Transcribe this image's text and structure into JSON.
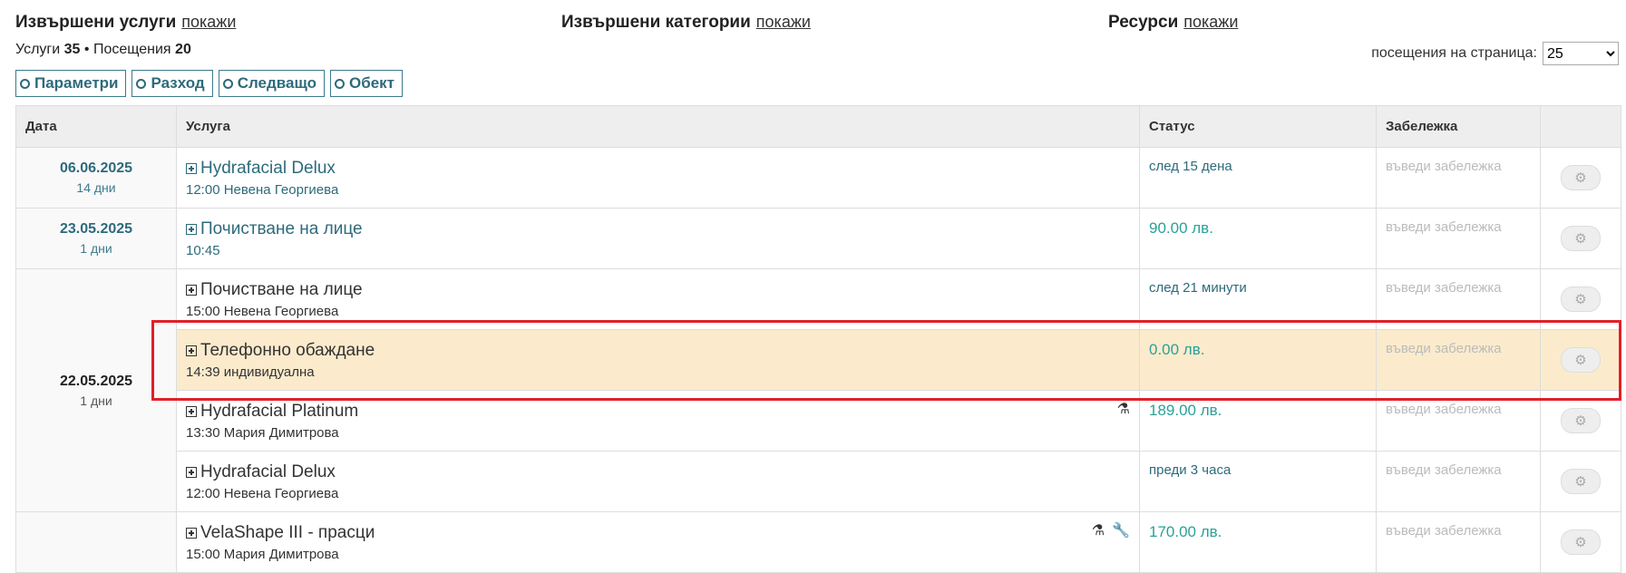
{
  "header": {
    "services_title": "Извършени услуги",
    "categories_title": "Извършени категории",
    "resources_title": "Ресурси",
    "show_link": "покажи"
  },
  "counts": {
    "services_label": "Услуги",
    "services_value": "35",
    "separator": "•",
    "visits_label": "Посещения",
    "visits_value": "20"
  },
  "perpage": {
    "label": "посещения на страница:",
    "selected": "25"
  },
  "filters": [
    "Параметри",
    "Разход",
    "Следващо",
    "Обект"
  ],
  "table": {
    "headers": [
      "Дата",
      "Услуга",
      "Статус",
      "Забележка",
      ""
    ],
    "groups": [
      {
        "date": "06.06.2025",
        "days": "14 дни",
        "rows": [
          {
            "service": "Hydrafacial Delux",
            "details": "12:00 Невена Георгиева",
            "status": "след 15 дена",
            "note": "въведи забележка"
          }
        ]
      },
      {
        "date": "23.05.2025",
        "days": "1 дни",
        "rows": [
          {
            "service": "Почистване на лице",
            "details": "10:45",
            "status": "90.00 лв.",
            "note": "въведи забележка"
          }
        ]
      },
      {
        "date": "22.05.2025",
        "days": "1 дни",
        "rows": [
          {
            "service": "Почистване на лице",
            "details": "15:00 Невена Георгиева",
            "status": "след 21 минути",
            "note": "въведи забележка"
          },
          {
            "service": "Телефонно обаждане",
            "details": "14:39 индивидуална",
            "status": "0.00 лв.",
            "note": "въведи забележка"
          },
          {
            "service": "Hydrafacial Platinum",
            "details": "13:30 Мария Димитрова",
            "status": "189.00 лв.",
            "note": "въведи забележка",
            "icons": [
              "flask-icon"
            ]
          },
          {
            "service": "Hydrafacial Delux",
            "details": "12:00 Невена Георгиева",
            "status": "преди 3 часа",
            "note": "въведи забележка"
          }
        ]
      },
      {
        "date": "",
        "days": "",
        "rows": [
          {
            "service": "VelaShape III - прасци",
            "details": "15:00 Мария Димитрова",
            "status": "170.00 лв.",
            "note": "въведи забележка",
            "icons": [
              "flask-icon",
              "wrench-icon"
            ]
          }
        ]
      }
    ]
  },
  "colors": {
    "accent": "#2d6a7c",
    "money": "#2aa198",
    "highlight_row": "#fbebcc",
    "highlight_border": "#e0202a"
  }
}
